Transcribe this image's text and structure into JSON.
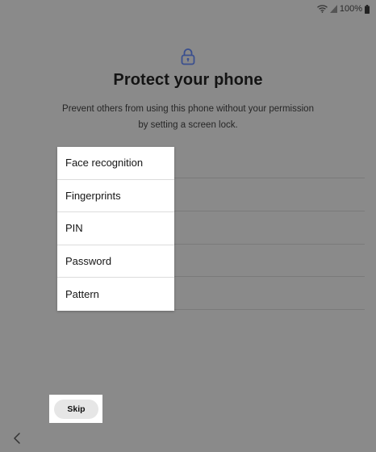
{
  "status_bar": {
    "battery_text": "100%",
    "icons": [
      "wifi-icon",
      "signal-icon",
      "battery-icon"
    ]
  },
  "header": {
    "icon": "lock-icon",
    "title": "Protect your phone",
    "subtitle": "Prevent others from using this phone without your permission by setting a screen lock."
  },
  "lock_options": [
    {
      "label": "Face recognition"
    },
    {
      "label": "Fingerprints"
    },
    {
      "label": "PIN"
    },
    {
      "label": "Password"
    },
    {
      "label": "Pattern"
    }
  ],
  "footer": {
    "skip_label": "Skip",
    "back_icon": "chevron-left-icon"
  },
  "colors": {
    "accent": "#3a4f8f",
    "overlay_background": "#8a8a8a",
    "menu_background": "#ffffff"
  }
}
